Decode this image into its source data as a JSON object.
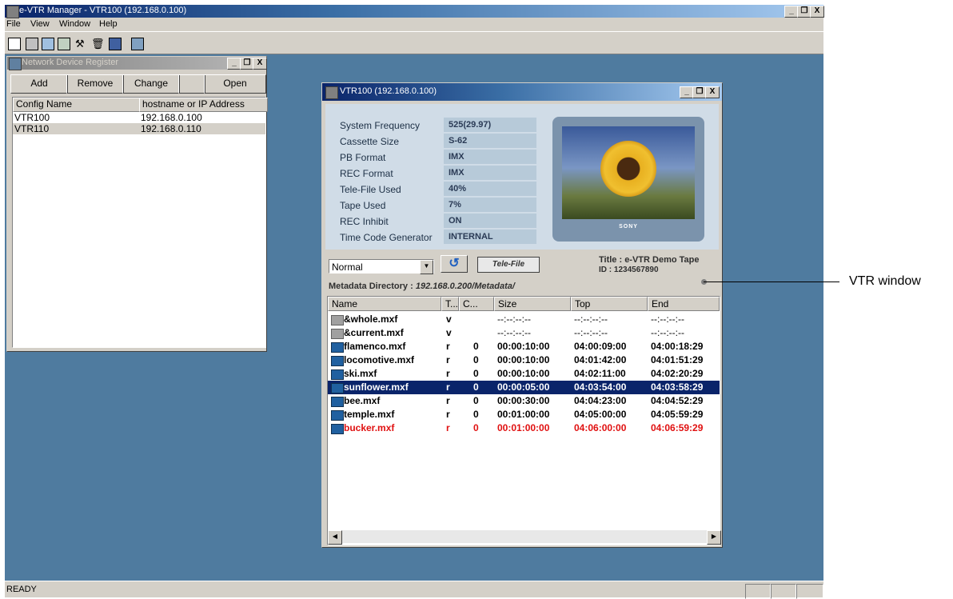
{
  "app": {
    "title": "e-VTR Manager - VTR100 (192.168.0.100)",
    "menu": [
      "File",
      "View",
      "Window",
      "Help"
    ],
    "window_buttons": [
      "_",
      "❐",
      "X"
    ],
    "status": "READY"
  },
  "network_device_register": {
    "title": "Network Device Register",
    "buttons": {
      "add": "Add",
      "remove": "Remove",
      "change": "Change",
      "open": "Open"
    },
    "columns": [
      "Config Name",
      "hostname or IP Address"
    ],
    "rows": [
      {
        "name": "VTR100",
        "address": "192.168.0.100"
      },
      {
        "name": "VTR110",
        "address": "192.168.0.110"
      }
    ]
  },
  "vtr_window": {
    "title": "VTR100 (192.168.0.100)",
    "info": [
      {
        "label": "System Frequency",
        "value": "525(29.97)"
      },
      {
        "label": "Cassette Size",
        "value": "S-62"
      },
      {
        "label": "PB Format",
        "value": "IMX"
      },
      {
        "label": "REC Format",
        "value": "IMX"
      },
      {
        "label": "Tele-File Used",
        "value": "40%"
      },
      {
        "label": "Tape Used",
        "value": "7%"
      },
      {
        "label": "REC Inhibit",
        "value": "ON"
      },
      {
        "label": "Time Code Generator",
        "value": "INTERNAL"
      }
    ],
    "brand": "SONY",
    "mode_select": "Normal",
    "telefile_button": "Tele-File",
    "tape_title": "Title : e-VTR Demo Tape",
    "tape_id": "ID : 1234567890",
    "metadata_label": "Metadata Directory :",
    "metadata_path": "192.168.0.200/Metadata/",
    "columns": [
      "Name",
      "T...",
      "C...",
      "Size",
      "Top",
      "End"
    ],
    "files": [
      {
        "name": "&whole.mxf",
        "t": "v",
        "c": "",
        "size": "--:--:--:--",
        "top": "--:--:--:--",
        "end": "--:--:--:--"
      },
      {
        "name": "&current.mxf",
        "t": "v",
        "c": "",
        "size": "--:--:--:--",
        "top": "--:--:--:--",
        "end": "--:--:--:--"
      },
      {
        "name": "flamenco.mxf",
        "t": "r",
        "c": "0",
        "size": "00:00:10:00",
        "top": "04:00:09:00",
        "end": "04:00:18:29"
      },
      {
        "name": "locomotive.mxf",
        "t": "r",
        "c": "0",
        "size": "00:00:10:00",
        "top": "04:01:42:00",
        "end": "04:01:51:29"
      },
      {
        "name": "ski.mxf",
        "t": "r",
        "c": "0",
        "size": "00:00:10:00",
        "top": "04:02:11:00",
        "end": "04:02:20:29"
      },
      {
        "name": "sunflower.mxf",
        "t": "r",
        "c": "0",
        "size": "00:00:05:00",
        "top": "04:03:54:00",
        "end": "04:03:58:29"
      },
      {
        "name": "bee.mxf",
        "t": "r",
        "c": "0",
        "size": "00:00:30:00",
        "top": "04:04:23:00",
        "end": "04:04:52:29"
      },
      {
        "name": "temple.mxf",
        "t": "r",
        "c": "0",
        "size": "00:01:00:00",
        "top": "04:05:00:00",
        "end": "04:05:59:29"
      },
      {
        "name": "bucker.mxf",
        "t": "r",
        "c": "0",
        "size": "00:01:00:00",
        "top": "04:06:00:00",
        "end": "04:06:59:29"
      }
    ]
  },
  "callout": {
    "label": "VTR window"
  }
}
